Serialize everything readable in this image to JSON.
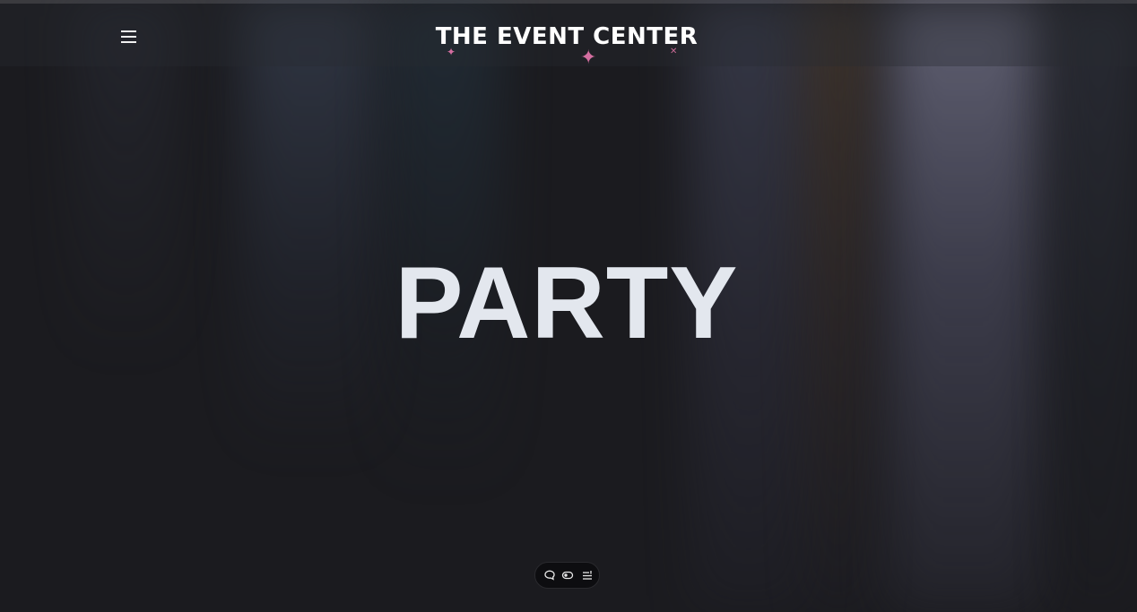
{
  "header": {
    "logo_text": "THE EVENT CENTER",
    "menu_icon": "hamburger-menu-icon",
    "sparkle_color": "#d46ea0"
  },
  "hero": {
    "title": "PARTY"
  },
  "toolbar": {
    "icons": [
      "chat-bubble-icon",
      "toggle-view-icon",
      "list-settings-icon"
    ]
  },
  "colors": {
    "background": "#1b1b1f",
    "hero_text": "#e3e7ee",
    "accent": "#d46ea0"
  }
}
